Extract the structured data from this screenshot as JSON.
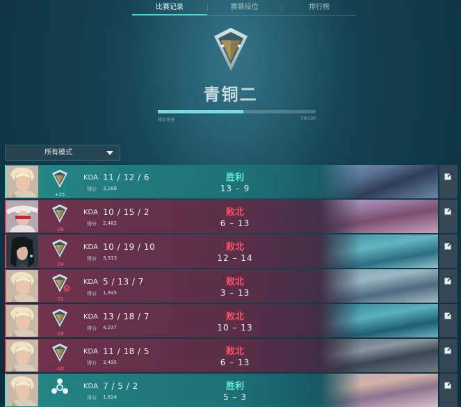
{
  "tabs": [
    {
      "label": "比赛记录",
      "active": true
    },
    {
      "label": "赛幕段位",
      "active": false
    },
    {
      "label": "排行榜",
      "active": false
    }
  ],
  "rank": {
    "title": "青铜二",
    "progress_label": "段位评分",
    "progress_value": "54/100",
    "progress_fraction": 0.54
  },
  "mode_select": {
    "label": "所有模式",
    "icon": "caret-down-icon"
  },
  "stat_labels": {
    "kda": "KDA",
    "score": "得分"
  },
  "matches": [
    {
      "outcome": "win",
      "result": "胜利",
      "rank_delta": "+25",
      "kda": "11 / 12 / 6",
      "score_pts": "3,166",
      "round_score": "13 – 9",
      "agent": "blonde",
      "rank_icon": "bronze"
    },
    {
      "outcome": "loss",
      "result": "败北",
      "rank_delta": "-26",
      "kda": "10 / 15 / 2",
      "score_pts": "2,482",
      "round_score": "6 – 13",
      "agent": "hat",
      "rank_icon": "bronze"
    },
    {
      "outcome": "loss",
      "result": "败北",
      "rank_delta": "-24",
      "kda": "10 / 19 / 10",
      "score_pts": "3,313",
      "round_score": "12 – 14",
      "agent": "dark",
      "rank_icon": "bronze"
    },
    {
      "outcome": "loss",
      "result": "败北",
      "rank_delta": "-21",
      "kda": "5 / 13 / 7",
      "score_pts": "1,945",
      "round_score": "3 – 13",
      "agent": "blonde",
      "rank_icon": "bronze",
      "demotion_marker": true
    },
    {
      "outcome": "loss",
      "result": "败北",
      "rank_delta": "-26",
      "kda": "13 / 18 / 7",
      "score_pts": "4,237",
      "round_score": "10 – 13",
      "agent": "blonde",
      "rank_icon": "bronze"
    },
    {
      "outcome": "loss",
      "result": "败北",
      "rank_delta": "-10",
      "kda": "11 / 18 / 5",
      "score_pts": "3,495",
      "round_score": "6 – 13",
      "agent": "blonde",
      "rank_icon": "bronze"
    },
    {
      "outcome": "win",
      "result": "胜利",
      "rank_delta": "",
      "kda": "7 / 5 / 2",
      "score_pts": "1,624",
      "round_score": "5 – 3",
      "agent": "blonde",
      "rank_icon": "unrated"
    }
  ],
  "colors": {
    "win": "#5fe8d8",
    "loss": "#ff5468",
    "accent": "#4fd6cf"
  }
}
